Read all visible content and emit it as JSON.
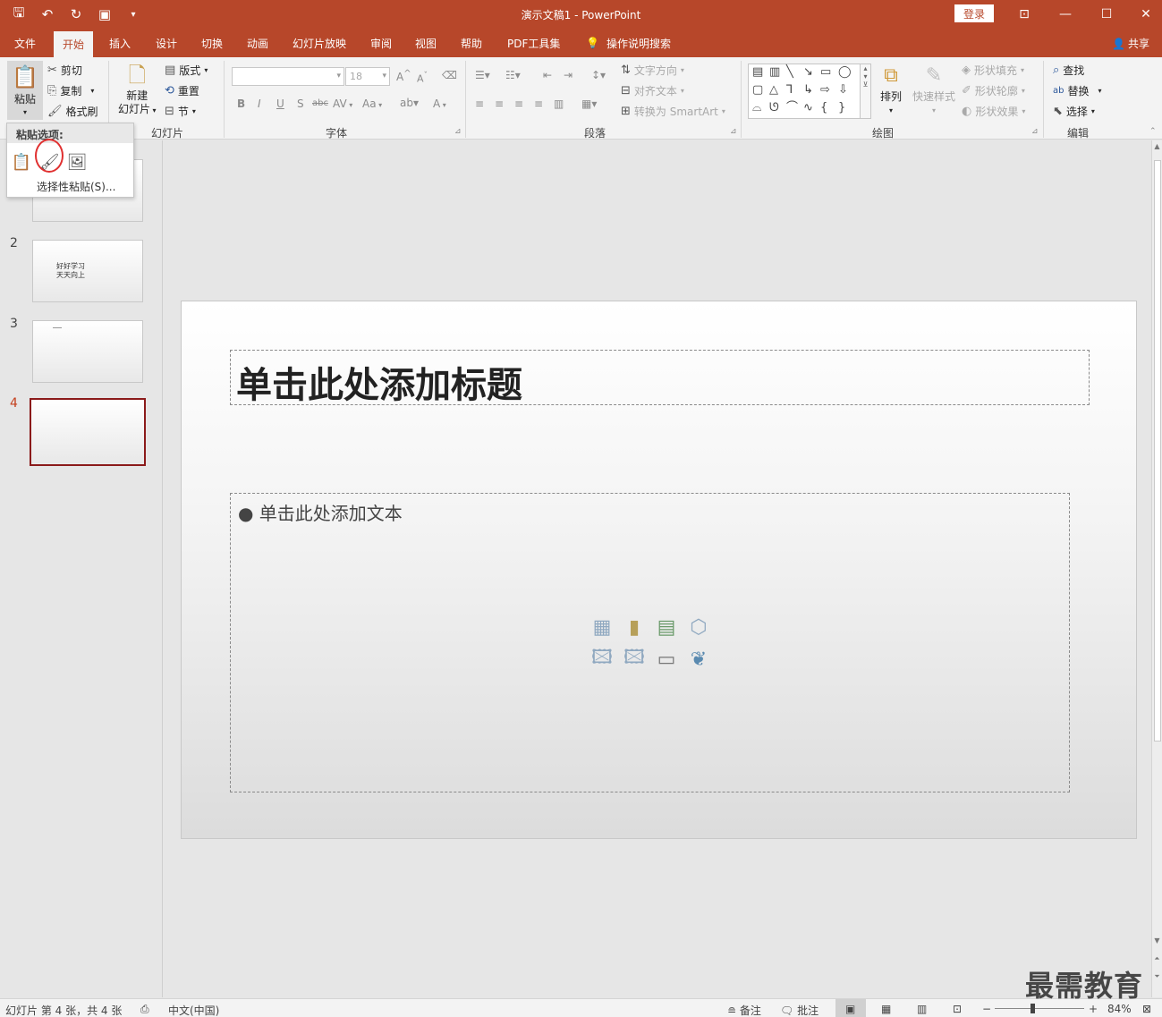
{
  "titlebar": {
    "doc_title": "演示文稿1  -  PowerPoint",
    "login": "登录",
    "icons": [
      "save-icon",
      "undo-icon",
      "redo-icon",
      "start-from-beginning-icon",
      "customize-qat-icon"
    ]
  },
  "tabs": {
    "items": [
      "文件",
      "开始",
      "插入",
      "设计",
      "切换",
      "动画",
      "幻灯片放映",
      "审阅",
      "视图",
      "帮助",
      "PDF工具集",
      "操作说明搜索"
    ],
    "active": "开始",
    "share": "共享"
  },
  "ribbon": {
    "clipboard": {
      "paste": "粘贴",
      "cut": "剪切",
      "copy": "复制",
      "format_painter": "格式刷"
    },
    "slides": {
      "new_slide_1": "新建",
      "new_slide_2": "幻灯片",
      "layout": "版式",
      "reset": "重置",
      "section": "节",
      "label": "幻灯片"
    },
    "font": {
      "size": "18",
      "bold": "B",
      "italic": "I",
      "underline": "U",
      "shadow": "S",
      "strike": "abc",
      "spacing": "AV",
      "case": "Aa",
      "color": "A",
      "label": "字体"
    },
    "paragraph": {
      "text_direction": "文字方向",
      "align_text": "对齐文本",
      "smartart": "转换为 SmartArt",
      "label": "段落"
    },
    "drawing": {
      "arrange": "排列",
      "quick_styles": "快速样式",
      "shape_fill": "形状填充",
      "shape_outline": "形状轮廓",
      "shape_effects": "形状效果",
      "label": "绘图"
    },
    "editing": {
      "find": "查找",
      "replace": "替换",
      "select": "选择",
      "label": "编辑"
    }
  },
  "paste_menu": {
    "header": "粘贴选项:",
    "link": "选择性粘贴(S)..."
  },
  "thumbnails": [
    {
      "num": "2",
      "text_1": "好好学习",
      "text_2": "天天向上"
    },
    {
      "num": "3"
    },
    {
      "num": "4"
    }
  ],
  "slide": {
    "title_placeholder": "单击此处添加标题",
    "body_placeholder": "● 单击此处添加文本"
  },
  "statusbar": {
    "slide_info": "幻灯片 第 4 张，共 4 张",
    "language": "中文(中国)",
    "notes": "备注",
    "comments": "批注",
    "zoom": "84%"
  },
  "watermark": "最需教育",
  "colors": {
    "accent": "#b7472a",
    "selected_thumb": "#8b1a1a"
  }
}
